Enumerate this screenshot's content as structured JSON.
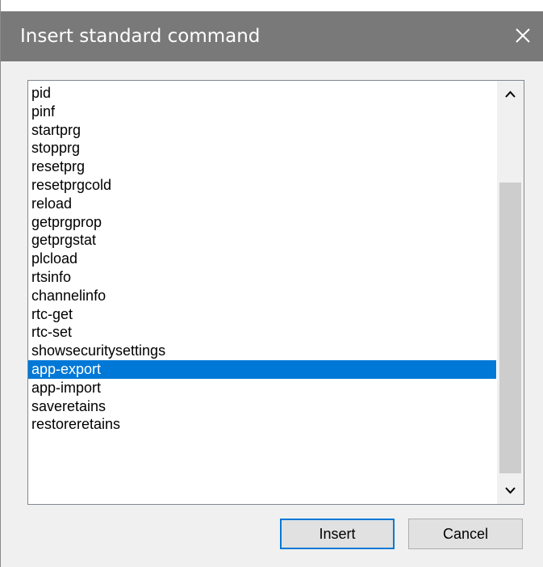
{
  "dialog": {
    "title": "Insert standard command",
    "close_glyph": "✕"
  },
  "commands": [
    "pid",
    "pinf",
    "startprg",
    "stopprg",
    "resetprg",
    "resetprgcold",
    "reload",
    "getprgprop",
    "getprgstat",
    "plcload",
    "rtsinfo",
    "channelinfo",
    "rtc-get",
    "rtc-set",
    "showsecuritysettings",
    "app-export",
    "app-import",
    "saveretains",
    "restoreretains"
  ],
  "selected_command": "app-export",
  "scrollbar": {
    "up_icon": "chevron-up-icon",
    "down_icon": "chevron-down-icon"
  },
  "buttons": {
    "insert_label": "Insert",
    "cancel_label": "Cancel"
  },
  "colors": {
    "titlebar": "#797979",
    "selection": "#0078d7",
    "default_button_border": "#0078d7"
  }
}
